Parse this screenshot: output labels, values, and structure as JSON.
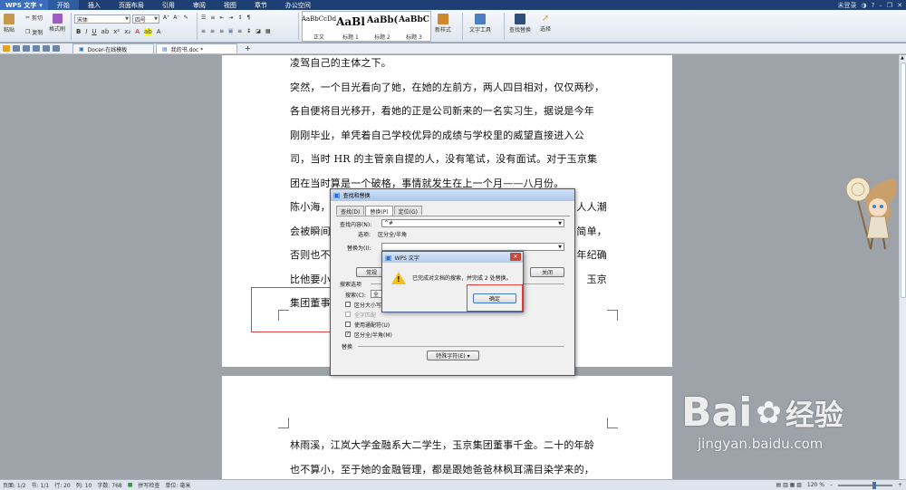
{
  "app": {
    "name": "WPS 文字",
    "menu_tabs": [
      "开始",
      "插入",
      "页面布局",
      "引用",
      "审阅",
      "视图",
      "章节",
      "办公空间"
    ],
    "login": "未登录"
  },
  "ribbon": {
    "paste": "粘贴",
    "cut": "剪切",
    "copy": "复制",
    "format_painter": "格式刷",
    "font": "宋体",
    "font_size": "四号",
    "styles": [
      {
        "sample": "AaBbCcDd",
        "label": "正文"
      },
      {
        "sample": "AaBl",
        "label": "标题 1"
      },
      {
        "sample": "AaBb(",
        "label": "标题 2"
      },
      {
        "sample": "AaBbC",
        "label": "标题 3"
      }
    ],
    "new_style": "新样式",
    "text_tools": "文字工具",
    "find_replace": "查找替换",
    "select": "选择"
  },
  "tabs": {
    "tab1": "Docer-在线模板",
    "tab2": "我的书.doc *",
    "add": "+"
  },
  "document": {
    "page1_lines": [
      "凌驾自己的主体之下。",
      "突然，一个目光看向了她，在她的左前方，两人四目相对，仅仅两秒，",
      "各自便将目光移开，看她的正是公司新来的一名实习生，据说是今年",
      "刚刚毕业，单凭着自己学校优异的成绩与学校里的威望直接进入公",
      "司，当时 HR 的主管亲自提的人，没有笔试，没有面试。对于玉京集",
      "团在当时算是一个破格，事情就发生在上一个月——八月份。"
    ],
    "partial_lines": [
      {
        "left": "陈小海，",
        "right": "人人潮"
      },
      {
        "left": "会被瞬间",
        "right": "简单，"
      },
      {
        "left": "否则也不",
        "right": "年纪确"
      },
      {
        "left": "比他要小",
        "right": "玉京"
      },
      {
        "left": "集团董事",
        "right": ""
      }
    ],
    "page2_lines": [
      "林雨溪，江岚大学金融系大二学生，玉京集团董事千金。二十的年龄",
      "也不算小，至于她的金融管理，都是跟她爸爸林枫耳濡目染学来的，"
    ]
  },
  "find_dialog": {
    "title": "查找和替换",
    "tabs": [
      "查找(D)",
      "替换(P)",
      "定位(G)"
    ],
    "find_label": "查找内容(N):",
    "find_value": "^#",
    "options_label": "选项:",
    "options_value": "区分全/半角",
    "replace_label": "替换为(I):",
    "btn_normal": "常规",
    "btn_close": "关闭",
    "search_options": "搜索选项",
    "search_label": "搜索(C):",
    "search_value": "全",
    "check_case": "区分大小写",
    "check_whole": "全字匹配",
    "check_wildcard": "使用通配符(U)",
    "check_width": "区分全/半角(M)",
    "replace_section": "替换",
    "special_btn": "特殊字符(E) ▾"
  },
  "message_box": {
    "title": "WPS 文字",
    "message": "已完成对文档的搜索，并完成 2 处替换。",
    "ok": "确定"
  },
  "status": {
    "page": "页面: 1/2",
    "section": "节: 1/1",
    "line": "行: 20",
    "column": "列: 10",
    "words": "字数: 768",
    "spell": "拼写检查",
    "unit": "单位: 毫米",
    "zoom": "120 %"
  },
  "watermark": {
    "brand": "Bai",
    "brand_cn": "经验",
    "url": "jingyan.baidu.com"
  },
  "colors": {
    "title_bar": "#1d3f73",
    "highlight_red": "#e04040",
    "warning": "#f2c218"
  }
}
